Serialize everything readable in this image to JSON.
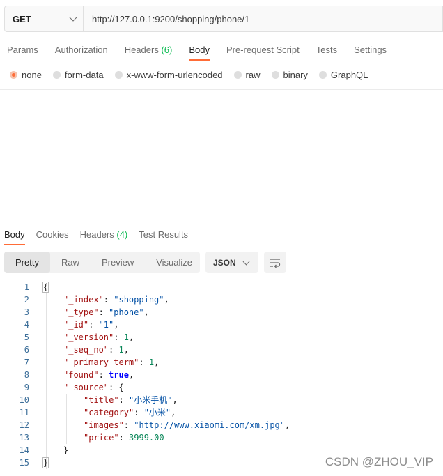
{
  "request": {
    "method": "GET",
    "url": "http://127.0.0.1:9200/shopping/phone/1"
  },
  "request_tabs": [
    {
      "label": "Params"
    },
    {
      "label": "Authorization"
    },
    {
      "label": "Headers",
      "count": "(6)"
    },
    {
      "label": "Body",
      "active": true
    },
    {
      "label": "Pre-request Script"
    },
    {
      "label": "Tests"
    },
    {
      "label": "Settings"
    }
  ],
  "body_types": [
    "none",
    "form-data",
    "x-www-form-urlencoded",
    "raw",
    "binary",
    "GraphQL"
  ],
  "body_type_selected": "none",
  "response_tabs": [
    {
      "label": "Body",
      "active": true
    },
    {
      "label": "Cookies"
    },
    {
      "label": "Headers",
      "count": "(4)"
    },
    {
      "label": "Test Results"
    }
  ],
  "view_modes": [
    "Pretty",
    "Raw",
    "Preview",
    "Visualize"
  ],
  "view_mode_selected": "Pretty",
  "format": "JSON",
  "code_lines": [
    {
      "n": "1",
      "indent": 0,
      "tokens": [
        {
          "t": "p",
          "v": "{"
        }
      ]
    },
    {
      "n": "2",
      "indent": 1,
      "tokens": [
        {
          "t": "k",
          "v": "\"_index\""
        },
        {
          "t": "p",
          "v": ": "
        },
        {
          "t": "s",
          "v": "\"shopping\""
        },
        {
          "t": "p",
          "v": ","
        }
      ]
    },
    {
      "n": "3",
      "indent": 1,
      "tokens": [
        {
          "t": "k",
          "v": "\"_type\""
        },
        {
          "t": "p",
          "v": ": "
        },
        {
          "t": "s",
          "v": "\"phone\""
        },
        {
          "t": "p",
          "v": ","
        }
      ]
    },
    {
      "n": "4",
      "indent": 1,
      "tokens": [
        {
          "t": "k",
          "v": "\"_id\""
        },
        {
          "t": "p",
          "v": ": "
        },
        {
          "t": "s",
          "v": "\"1\""
        },
        {
          "t": "p",
          "v": ","
        }
      ]
    },
    {
      "n": "5",
      "indent": 1,
      "tokens": [
        {
          "t": "k",
          "v": "\"_version\""
        },
        {
          "t": "p",
          "v": ": "
        },
        {
          "t": "n",
          "v": "1"
        },
        {
          "t": "p",
          "v": ","
        }
      ]
    },
    {
      "n": "6",
      "indent": 1,
      "tokens": [
        {
          "t": "k",
          "v": "\"_seq_no\""
        },
        {
          "t": "p",
          "v": ": "
        },
        {
          "t": "n",
          "v": "1"
        },
        {
          "t": "p",
          "v": ","
        }
      ]
    },
    {
      "n": "7",
      "indent": 1,
      "tokens": [
        {
          "t": "k",
          "v": "\"_primary_term\""
        },
        {
          "t": "p",
          "v": ": "
        },
        {
          "t": "n",
          "v": "1"
        },
        {
          "t": "p",
          "v": ","
        }
      ]
    },
    {
      "n": "8",
      "indent": 1,
      "tokens": [
        {
          "t": "k",
          "v": "\"found\""
        },
        {
          "t": "p",
          "v": ": "
        },
        {
          "t": "b",
          "v": "true"
        },
        {
          "t": "p",
          "v": ","
        }
      ]
    },
    {
      "n": "9",
      "indent": 1,
      "tokens": [
        {
          "t": "k",
          "v": "\"_source\""
        },
        {
          "t": "p",
          "v": ": {"
        }
      ]
    },
    {
      "n": "10",
      "indent": 2,
      "tokens": [
        {
          "t": "k",
          "v": "\"title\""
        },
        {
          "t": "p",
          "v": ": "
        },
        {
          "t": "s",
          "v": "\"小米手机\""
        },
        {
          "t": "p",
          "v": ","
        }
      ]
    },
    {
      "n": "11",
      "indent": 2,
      "tokens": [
        {
          "t": "k",
          "v": "\"category\""
        },
        {
          "t": "p",
          "v": ": "
        },
        {
          "t": "s",
          "v": "\"小米\""
        },
        {
          "t": "p",
          "v": ","
        }
      ]
    },
    {
      "n": "12",
      "indent": 2,
      "tokens": [
        {
          "t": "k",
          "v": "\"images\""
        },
        {
          "t": "p",
          "v": ": "
        },
        {
          "t": "s",
          "v": "\""
        },
        {
          "t": "lk",
          "v": "http://www.xiaomi.com/xm.jpg"
        },
        {
          "t": "s",
          "v": "\""
        },
        {
          "t": "p",
          "v": ","
        }
      ]
    },
    {
      "n": "13",
      "indent": 2,
      "tokens": [
        {
          "t": "k",
          "v": "\"price\""
        },
        {
          "t": "p",
          "v": ": "
        },
        {
          "t": "n",
          "v": "3999.00"
        }
      ]
    },
    {
      "n": "14",
      "indent": 1,
      "tokens": [
        {
          "t": "p",
          "v": "}"
        }
      ]
    },
    {
      "n": "15",
      "indent": 0,
      "tokens": [
        {
          "t": "p",
          "v": "}"
        }
      ]
    }
  ],
  "watermark": "CSDN @ZHOU_VIP"
}
